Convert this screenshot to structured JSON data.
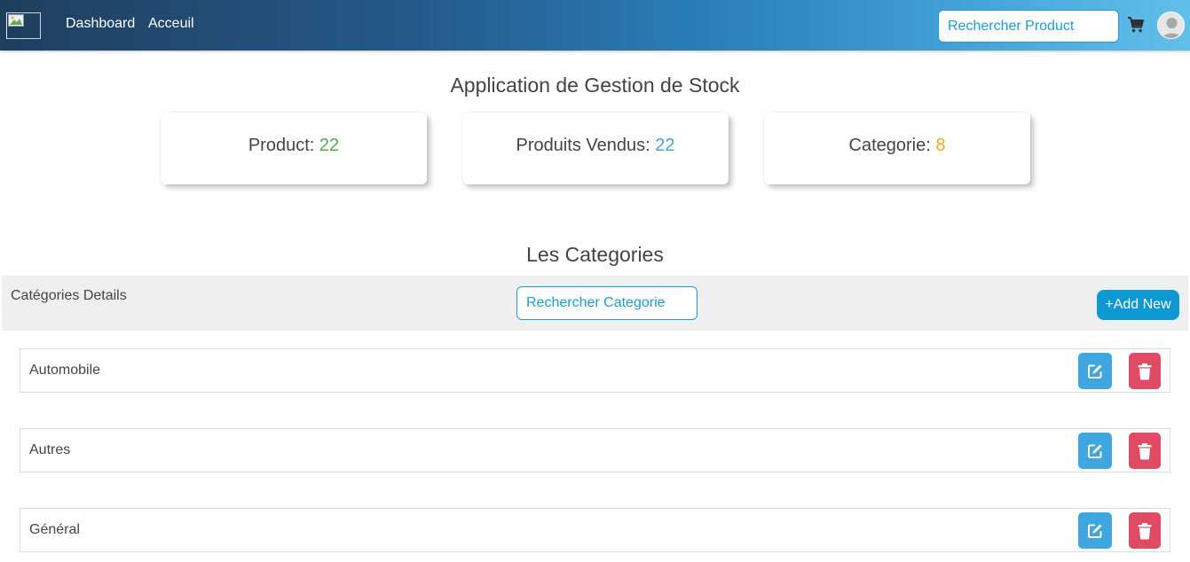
{
  "nav": {
    "links": [
      "Dashboard",
      "Acceuil"
    ],
    "search_placeholder": "Rechercher Product"
  },
  "app_title": "Application de Gestion de Stock",
  "stats": [
    {
      "label": "Product:",
      "value": "22",
      "color": "#4caf50"
    },
    {
      "label": "Produits Vendus:",
      "value": "22",
      "color": "#42a5d8"
    },
    {
      "label": "Categorie:",
      "value": "8",
      "color": "#f5a623"
    }
  ],
  "section_title": "Les Categories",
  "details": {
    "label": "Catégories Details",
    "search_placeholder": "Rechercher Categorie",
    "add_label": "+Add New"
  },
  "categories": [
    "Automobile",
    "Autres",
    "Général"
  ],
  "icons": {
    "edit": "edit-icon",
    "delete": "trash-icon",
    "cart": "cart-icon",
    "avatar": "user-avatar-icon"
  },
  "colors": {
    "accent": "#1a9cd6",
    "edit": "#3fa6e0",
    "delete": "#e04a63"
  }
}
